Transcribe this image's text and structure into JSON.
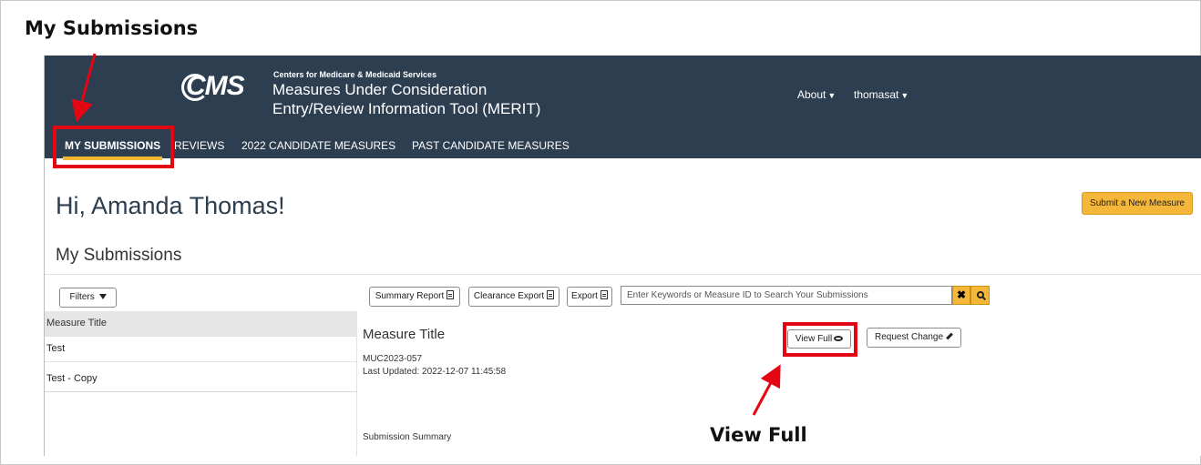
{
  "annotations": {
    "title": "My Submissions",
    "view_full_callout": "View Full",
    "highlight_color": "#e30613"
  },
  "header": {
    "org_name": "Centers for Medicare & Medicaid Services",
    "logo_text": "CMS",
    "tool_name_line1": "Measures Under Consideration",
    "tool_name_line2": "Entry/Review Information Tool (MERIT)",
    "about_label": "About",
    "user_label": "thomasat",
    "bg_color": "#2d3e50"
  },
  "nav": {
    "tabs": [
      {
        "label": "MY SUBMISSIONS",
        "active": true
      },
      {
        "label": "REVIEWS",
        "active": false
      },
      {
        "label": "2022 CANDIDATE MEASURES",
        "active": false
      },
      {
        "label": "PAST CANDIDATE MEASURES",
        "active": false
      }
    ],
    "active_underline_color": "#f2b930"
  },
  "main": {
    "greeting": "Hi, Amanda Thomas!",
    "submit_button": "Submit a New Measure",
    "section_title": "My Submissions",
    "toolbar": {
      "filters": "Filters",
      "summary_report": "Summary Report",
      "clearance_export": "Clearance Export",
      "export": "Export",
      "search_placeholder": "Enter Keywords or Measure ID to Search Your Submissions"
    },
    "list": {
      "header": "Measure Title",
      "items": [
        "Test",
        "Test - Copy"
      ]
    },
    "detail": {
      "title": "Measure Title",
      "measure_id": "MUC2023-057",
      "last_updated": "Last Updated: 2022-12-07 11:45:58",
      "view_full": "View Full",
      "request_change": "Request Change",
      "summary_label": "Submission Summary"
    }
  },
  "icons": [
    "cms-logo-icon",
    "caret-down-icon",
    "filter-icon",
    "document-icon",
    "clear-icon",
    "search-icon",
    "eye-icon",
    "pencil-icon"
  ]
}
